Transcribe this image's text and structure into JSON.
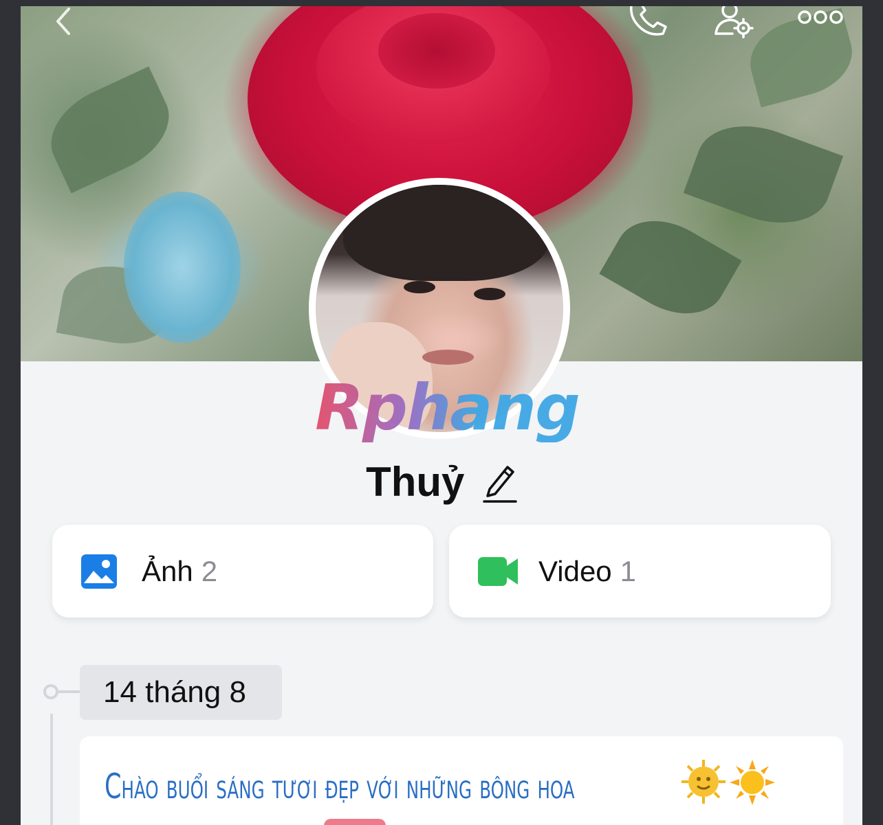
{
  "profile": {
    "name": "Thuỷ",
    "watermark_text": "Rphang"
  },
  "topbar": {
    "icons": [
      "back-icon",
      "phone-call-icon",
      "user-settings-icon",
      "more-icon"
    ]
  },
  "media": {
    "photos_label": "Ảnh",
    "photos_count": "2",
    "videos_label": "Video",
    "videos_count": "1"
  },
  "timeline": {
    "date_label": "14 tháng 8",
    "post_text": "Chào buổi sáng tươi đẹp với những bông hoa"
  },
  "colors": {
    "background": "#2f3137",
    "screen": "#f2f4f6",
    "photo_icon": "#1a7ee6",
    "video_icon": "#2fbf5c",
    "post_text": "#2a6ec4"
  }
}
